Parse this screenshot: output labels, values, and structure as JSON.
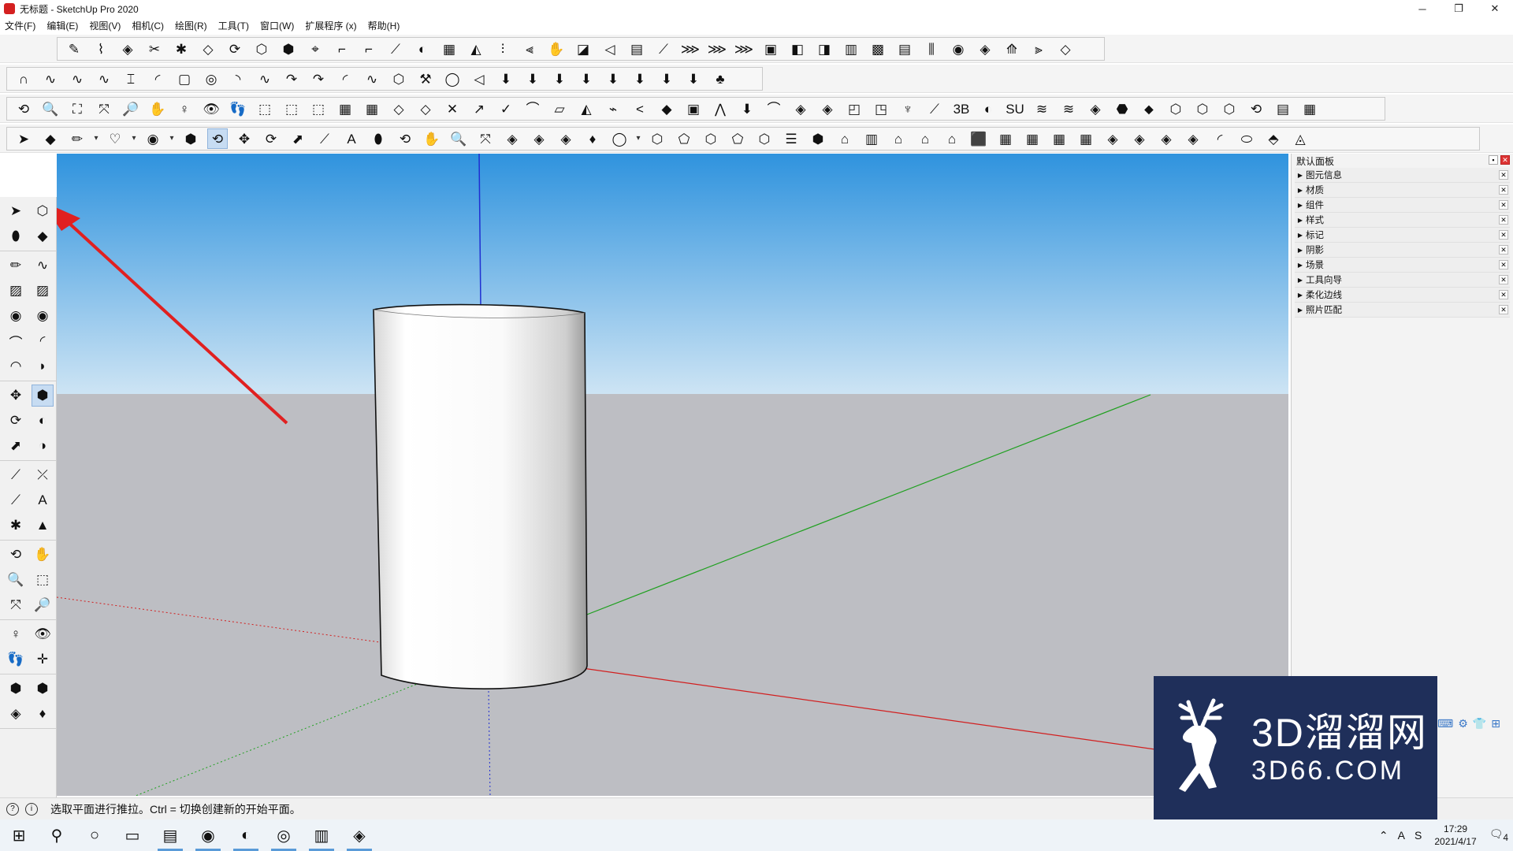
{
  "window": {
    "title": "无标题 - SketchUp Pro 2020",
    "minimize": "─",
    "restore": "❐",
    "close": "✕"
  },
  "menu": [
    "文件(F)",
    "编辑(E)",
    "视图(V)",
    "相机(C)",
    "绘图(R)",
    "工具(T)",
    "窗口(W)",
    "扩展程序 (x)",
    "帮助(H)"
  ],
  "colors": {
    "sky_top": "#2f93de",
    "sky_bottom": "#cde4f4",
    "ground": "#bdbec3",
    "axis_red": "#d21f1f",
    "axis_green": "#1fa01f",
    "axis_blue": "#1f2fd2",
    "annotation_arrow": "#e02020",
    "watermark_bg": "#1f2f5a"
  },
  "toolbars": {
    "row1": [
      "✎",
      "⌇",
      "◈",
      "✂",
      "✱",
      "◇",
      "⟳",
      "⬡",
      "⬢",
      "⌖",
      "⌐",
      "⌐",
      "⟋",
      "◐",
      "▦",
      "◭",
      "⫶",
      "⫷",
      "✋",
      "◪",
      "◁",
      "▤",
      "⟋",
      "⋙",
      "⋙",
      "⋙",
      "▣",
      "◧",
      "◨",
      "▥",
      "▩",
      "▤",
      "⫼",
      "◉",
      "◈",
      "⟰",
      "⫸",
      "◇"
    ],
    "row2": [
      "∩",
      "∿",
      "∿",
      "∿",
      "⌶",
      "◜",
      "▢",
      "◎",
      "◝",
      "∿",
      "↷",
      "↷",
      "◜",
      "∿",
      "⬡",
      "⚒",
      "◯",
      "◁",
      "⬇",
      "⬇",
      "⬇",
      "⬇",
      "⬇",
      "⬇",
      "⬇",
      "⬇",
      "♣"
    ],
    "row3": [
      "⟲",
      "🔍",
      "⛶",
      "⤧",
      "🔎",
      "✋",
      "♀",
      "👁",
      "👣",
      "⬚",
      "⬚",
      "⬚",
      "▦",
      "▦",
      "◇",
      "◇",
      "✕",
      "↗",
      "✓",
      "⌒",
      "▱",
      "◭",
      "⌁",
      "<",
      "◆",
      "▣",
      "⋀",
      "⬇",
      "⌒",
      "◈",
      "◈",
      "◰",
      "◳",
      "♆",
      "⟋",
      "3B",
      "◐",
      "SU",
      "≋",
      "≋",
      "◈",
      "⬣",
      "⬥",
      "⬡",
      "⬡",
      "⬡",
      "⟲",
      "▤",
      "▦"
    ],
    "row4": [
      "➤",
      "◆",
      "✏",
      "▾",
      "♡",
      "▾",
      "◉",
      "▾",
      "⬢",
      "⟲",
      "✥",
      "⟳",
      "⬈",
      "⟋",
      "A",
      "⬮",
      "⟲",
      "✋",
      "🔍",
      "⤧",
      "◈",
      "◈",
      "◈",
      "♦",
      "◯",
      "▾",
      "⬡",
      "⬠",
      "⬡",
      "⬠",
      "⬡",
      "☰",
      "⬢",
      "⌂",
      "▥",
      "⌂",
      "⌂",
      "⌂",
      "⬛",
      "▦",
      "▦",
      "▦",
      "▦",
      "◈",
      "◈",
      "◈",
      "◈",
      "◜",
      "⬭",
      "⬘",
      "◬"
    ]
  },
  "left_tools": [
    [
      "➤",
      "⬡"
    ],
    [
      "⬮",
      "◆"
    ],
    [
      "✏",
      "∿"
    ],
    [
      "▨",
      "▨"
    ],
    [
      "◉",
      "◉"
    ],
    [
      "⌒",
      "◜"
    ],
    [
      "◠",
      "◗"
    ],
    [
      "✥",
      "⬢"
    ],
    [
      "⟳",
      "◐"
    ],
    [
      "⬈",
      "◑"
    ],
    [
      "⟋",
      "⤫"
    ],
    [
      "⟋",
      "A"
    ],
    [
      "✱",
      "▲"
    ],
    [
      "⟲",
      "✋"
    ],
    [
      "🔍",
      "⬚"
    ],
    [
      "⤧",
      "🔎"
    ],
    [
      "♀",
      "👁"
    ],
    [
      "👣",
      "✛"
    ],
    [
      "⬢",
      "⬢"
    ],
    [
      "◈",
      "♦"
    ]
  ],
  "panel": {
    "title": "默认面板",
    "pin": "▪",
    "close": "✕",
    "trays": [
      "图元信息",
      "材质",
      "组件",
      "样式",
      "标记",
      "阴影",
      "场景",
      "工具向导",
      "柔化边线",
      "照片匹配"
    ],
    "tray_arrow": "▶",
    "tray_close": "✕"
  },
  "status": {
    "icon1": "?",
    "icon2": "i",
    "text": "选取平面进行推拉。Ctrl = 切换创建新的开始平面。"
  },
  "watermark": {
    "cn": "3D溜溜网",
    "en": "3D66.COM"
  },
  "ime_icons": [
    "⌨",
    "⚙",
    "👕",
    "⊞"
  ],
  "taskbar": {
    "apps": [
      "⊞",
      "⚲",
      "○",
      "▭",
      "▤",
      "◉",
      "◐",
      "◎",
      "▥",
      "◈"
    ],
    "running": [
      4,
      5,
      6,
      7,
      8,
      9
    ],
    "tray": [
      "⌃",
      "A",
      "S"
    ],
    "time": "17:29",
    "date": "2021/4/17",
    "notifications": "4"
  }
}
